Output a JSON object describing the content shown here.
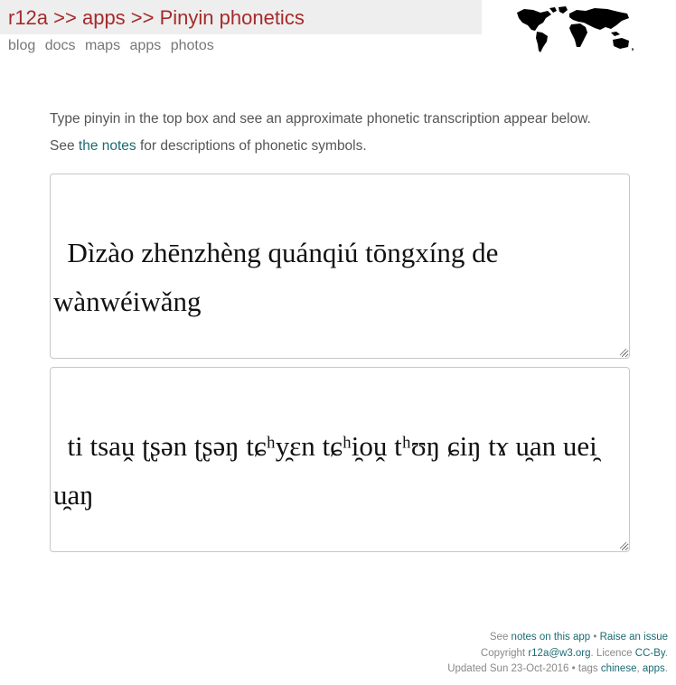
{
  "header": {
    "breadcrumb": {
      "site": "r12a",
      "sep1": " >> ",
      "section": "apps",
      "sep2": " >> ",
      "page": "Pinyin phonetics"
    },
    "nav": [
      "blog",
      "docs",
      "maps",
      "apps",
      "photos"
    ],
    "map_icon": "world-map-icon"
  },
  "intro": {
    "line1": "Type pinyin in the top box and see an approximate phonetic transcription appear below.",
    "line2_prefix": "See ",
    "line2_link": "the notes",
    "line2_suffix": " for descriptions of phonetic symbols."
  },
  "input": {
    "value": "Dìzào zhēnzhèng quánqiú tōngxíng de wànwéiwǎng"
  },
  "output": {
    "value": "ti tsaṷ ʈʂən ʈʂəŋ tɕʰy̯ɛn tɕʰi̯oṷ tʰʊŋ ɕiŋ tɤ u̯an uei̯ u̯aŋ"
  },
  "footer": {
    "line1_prefix": "See ",
    "notes_link": "notes on this app",
    "bullet": " • ",
    "issue_link": "Raise an issue",
    "copyright_prefix": "Copyright ",
    "email_link": "r12a@w3.org",
    "licence_prefix": ". Licence ",
    "licence_link": "CC-By",
    "licence_suffix": ".",
    "updated": "Updated Sun 23-Oct-2016",
    "tags_prefix": " • tags ",
    "tag1": "chinese",
    "tag_sep": ", ",
    "tag2": "apps",
    "tags_suffix": "."
  },
  "colors": {
    "title": "#a52a2a",
    "link": "#1b6a73",
    "title_bar_bg": "#eeeeee"
  }
}
